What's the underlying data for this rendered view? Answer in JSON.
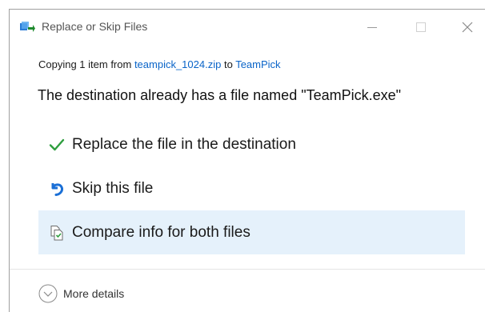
{
  "window": {
    "title": "Replace or Skip Files",
    "minimize_icon": "minimize-icon",
    "maximize_icon": "maximize-icon",
    "close_icon": "close-icon"
  },
  "copy_status": {
    "prefix": "Copying 1 item from ",
    "source": "teampick_1024.zip",
    "middle": " to ",
    "destination": "TeamPick"
  },
  "headline": "The destination already has a file named \"TeamPick.exe\"",
  "options": [
    {
      "label": "Replace the file in the destination",
      "icon": "checkmark-icon"
    },
    {
      "label": "Skip this file",
      "icon": "skip-arrow-icon"
    },
    {
      "label": "Compare info for both files",
      "icon": "compare-files-icon"
    }
  ],
  "footer": {
    "more_details_label": "More details",
    "icon": "chevron-down-circle-icon"
  },
  "colors": {
    "link": "#0a64c8",
    "check": "#2e9e3e",
    "skip_arrow": "#1a6fd6",
    "highlight": "#e5f1fb"
  }
}
